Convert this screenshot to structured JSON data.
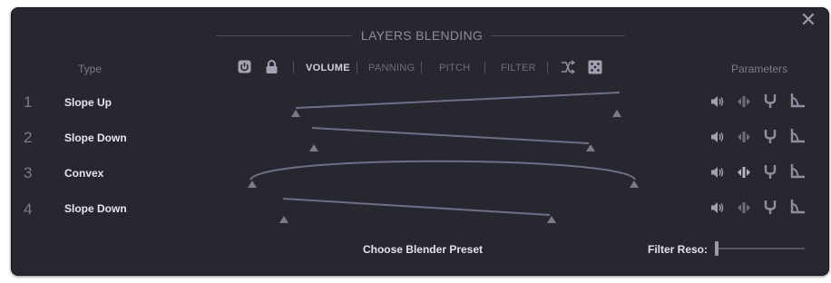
{
  "window": {
    "title": "LAYERS BLENDING",
    "close_glyph": "✕"
  },
  "header": {
    "type_label": "Type",
    "params_label": "Parameters"
  },
  "toolbar": {
    "power_icon": "power-icon",
    "lock_icon": "lock-icon",
    "tabs": [
      {
        "label": "VOLUME",
        "active": true
      },
      {
        "label": "PANNING",
        "active": false
      },
      {
        "label": "PITCH",
        "active": false
      },
      {
        "label": "FILTER",
        "active": false
      }
    ],
    "shuffle_icon": "shuffle-icon",
    "random_icon": "dice-icon"
  },
  "rows": [
    {
      "number": "1",
      "type": "Slope Up"
    },
    {
      "number": "2",
      "type": "Slope Down"
    },
    {
      "number": "3",
      "type": "Convex"
    },
    {
      "number": "4",
      "type": "Slope Down"
    }
  ],
  "param_icons": [
    "speaker-icon",
    "pan-icon",
    "pitch-fork-icon",
    "filter-icon"
  ],
  "footer": {
    "preset_label": "Choose Blender Preset",
    "filter_reso_label": "Filter Reso:",
    "filter_reso_value": 0
  },
  "colors": {
    "panel_bg": "#272730",
    "text_bright": "#e6e6ee",
    "text_dim": "#7c7c8a",
    "curve": "#6e6e86",
    "handle": "#7a7a8c",
    "icon": "#8e8ea0"
  }
}
